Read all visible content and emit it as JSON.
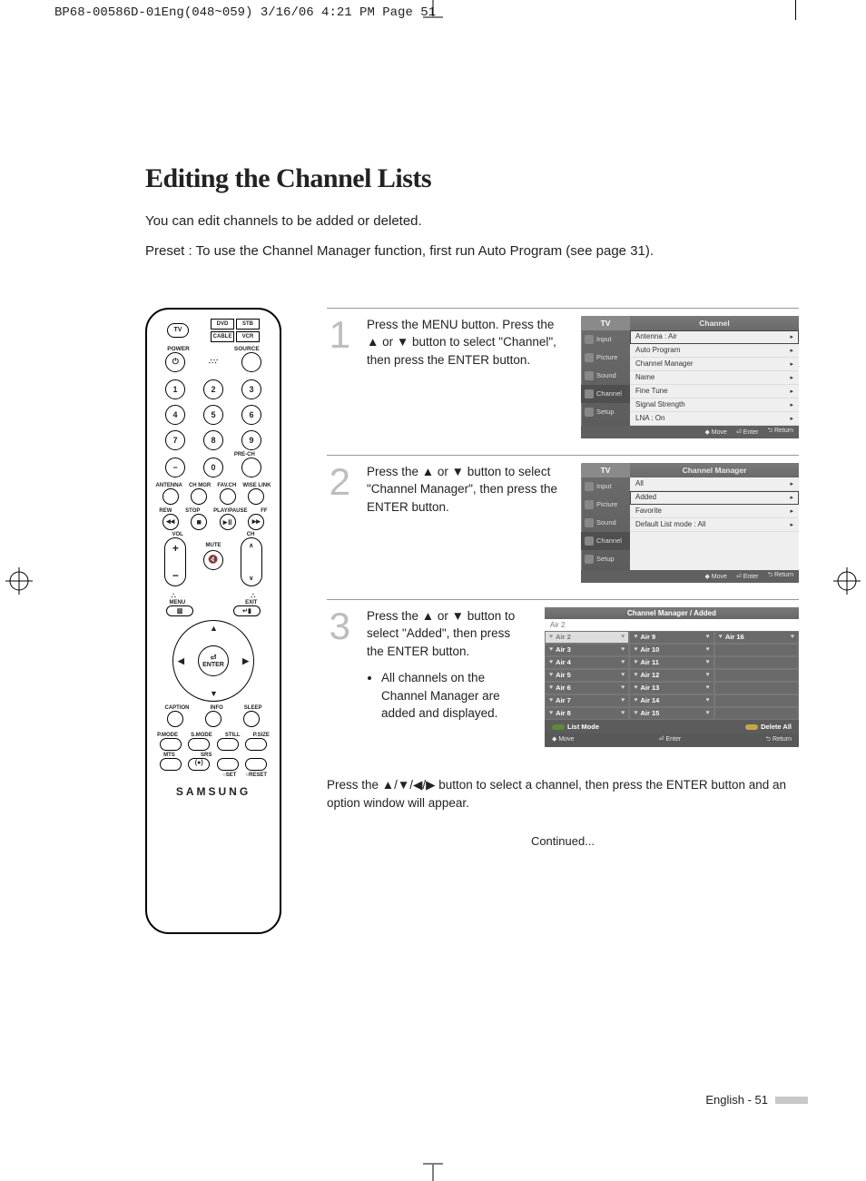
{
  "crop_header": "BP68-00586D-01Eng(048~059)  3/16/06  4:21 PM  Page 51",
  "title": "Editing the Channel Lists",
  "intro1": "You can edit channels to be added or deleted.",
  "intro2": "Preset : To use the Channel Manager function, first run Auto Program (see page 31).",
  "remote": {
    "tv": "TV",
    "mode_dvd": "DVD",
    "mode_stb": "STB",
    "mode_cable": "CABLE",
    "mode_vcr": "VCR",
    "power": "POWER",
    "source": "SOURCE",
    "nums": [
      "1",
      "2",
      "3",
      "4",
      "5",
      "6",
      "7",
      "8",
      "9",
      "0"
    ],
    "dash": "−",
    "prech": "PRE-CH",
    "row_labels": [
      "ANTENNA",
      "CH MGR",
      "FAV.CH",
      "WISE LINK"
    ],
    "transport": [
      "REW",
      "STOP",
      "PLAY/PAUSE",
      "FF"
    ],
    "vol": "VOL",
    "ch": "CH",
    "mute": "MUTE",
    "menu": "MENU",
    "exit": "EXIT",
    "enter": "ENTER",
    "caption": "CAPTION",
    "info": "INFO",
    "sleep": "SLEEP",
    "pmode": "P.MODE",
    "smode": "S.MODE",
    "still": "STILL",
    "psize": "P.SIZE",
    "mts": "MTS",
    "srs": "SRS",
    "set": "SET",
    "reset": "RESET",
    "brand": "SAMSUNG"
  },
  "steps": [
    {
      "n": "1",
      "text": "Press the MENU button. Press the ▲ or ▼ button to select \"Channel\", then press the ENTER button.",
      "osd": {
        "tv": "TV",
        "title": "Channel",
        "side": [
          "Input",
          "Picture",
          "Sound",
          "Channel",
          "Setup"
        ],
        "rows": [
          {
            "l": "Antenna",
            "v": ": Air",
            "sel": true
          },
          {
            "l": "Auto Program",
            "v": ""
          },
          {
            "l": "Channel Manager",
            "v": ""
          },
          {
            "l": "Name",
            "v": ""
          },
          {
            "l": "Fine Tune",
            "v": ""
          },
          {
            "l": "Signal Strength",
            "v": ""
          },
          {
            "l": "LNA",
            "v": ": On"
          }
        ],
        "foot": [
          "◆ Move",
          "⏎ Enter",
          "⮌ Return"
        ]
      }
    },
    {
      "n": "2",
      "text": "Press the ▲ or ▼ button to select \"Channel Manager\", then press the ENTER button.",
      "osd": {
        "tv": "TV",
        "title": "Channel Manager",
        "side": [
          "Input",
          "Picture",
          "Sound",
          "Channel",
          "Setup"
        ],
        "rows": [
          {
            "l": "All",
            "v": ""
          },
          {
            "l": "Added",
            "v": "",
            "sel": true
          },
          {
            "l": "Favorite",
            "v": ""
          },
          {
            "l": "Default List mode",
            "v": ": All"
          }
        ],
        "foot": [
          "◆ Move",
          "⏎ Enter",
          "⮌ Return"
        ]
      }
    },
    {
      "n": "3",
      "text": "Press the ▲ or ▼ button to select \"Added\", then press the ENTER button.",
      "bullet": "All channels on the Channel Manager are added and displayed.",
      "osd3": {
        "title": "Channel Manager / Added",
        "current": "Air 2",
        "col1": [
          "Air 2",
          "Air 3",
          "Air 4",
          "Air 5",
          "Air 6",
          "Air 7",
          "Air 8"
        ],
        "col2": [
          "Air 9",
          "Air 10",
          "Air 11",
          "Air 12",
          "Air 13",
          "Air 14",
          "Air 15"
        ],
        "col3": [
          "Air 16",
          "",
          "",
          "",
          "",
          "",
          ""
        ],
        "listmode": "List Mode",
        "deleteall": "Delete All",
        "foot": [
          "Move",
          "Enter",
          "Return"
        ]
      }
    }
  ],
  "posttext": "Press the ▲/▼/◀/▶ button to select a channel, then press the ENTER button and an option window will appear.",
  "continued": "Continued...",
  "footer": {
    "label": "English - 51"
  }
}
